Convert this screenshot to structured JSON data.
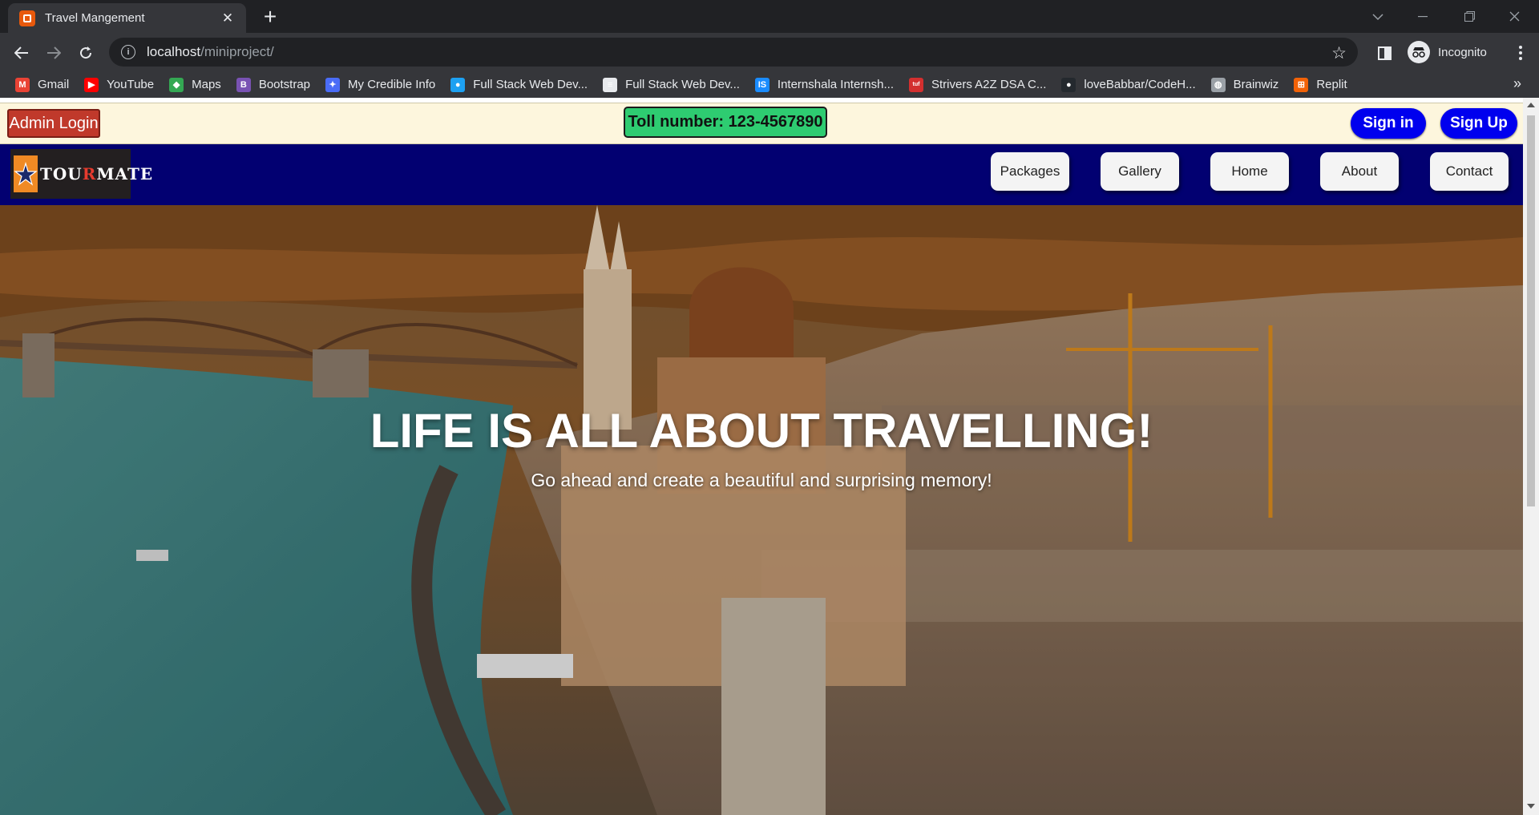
{
  "browser": {
    "tab_title": "Travel Mangement",
    "url_host": "localhost",
    "url_path": "/miniproject/",
    "profile_label": "Incognito",
    "bookmarks": [
      {
        "label": "Gmail",
        "icon": "gmail-icon",
        "color": "#ea4335",
        "glyph": "M"
      },
      {
        "label": "YouTube",
        "icon": "youtube-icon",
        "color": "#ff0000",
        "glyph": "▶"
      },
      {
        "label": "Maps",
        "icon": "maps-icon",
        "color": "#34a853",
        "glyph": "◆"
      },
      {
        "label": "Bootstrap",
        "icon": "bootstrap-icon",
        "color": "#7952b3",
        "glyph": "B"
      },
      {
        "label": "My Credible Info",
        "icon": "credible-icon",
        "color": "#4a6cf7",
        "glyph": "✦"
      },
      {
        "label": "Full Stack Web Dev...",
        "icon": "fullstack-icon",
        "color": "#1da1f2",
        "glyph": "●"
      },
      {
        "label": "Full Stack Web Dev...",
        "icon": "doc-icon",
        "color": "#e8eaed",
        "glyph": "≡"
      },
      {
        "label": "Internshala Internsh...",
        "icon": "internshala-icon",
        "color": "#1a8cff",
        "glyph": "IS"
      },
      {
        "label": "Strivers A2Z DSA C...",
        "icon": "tuf-icon",
        "color": "#d32f2f",
        "glyph": "tuf"
      },
      {
        "label": "loveBabbar/CodeH...",
        "icon": "github-icon",
        "color": "#24292e",
        "glyph": "●"
      },
      {
        "label": "Brainwiz",
        "icon": "globe-icon",
        "color": "#9aa0a6",
        "glyph": "◍"
      },
      {
        "label": "Replit",
        "icon": "replit-icon",
        "color": "#f26207",
        "glyph": "⊞"
      }
    ]
  },
  "topbar": {
    "admin_login": "Admin Login",
    "toll": "Toll number: 123-4567890",
    "sign_in": "Sign in",
    "sign_up": "Sign Up"
  },
  "logo": {
    "part1": "TOU",
    "part2": "R",
    "part3": "MATE"
  },
  "nav": {
    "items": [
      "Packages",
      "Gallery",
      "Home",
      "About",
      "Contact"
    ]
  },
  "hero": {
    "title": "LIFE IS ALL ABOUT TRAVELLING!",
    "subtitle": "Go ahead and create a beautiful and surprising memory!"
  }
}
